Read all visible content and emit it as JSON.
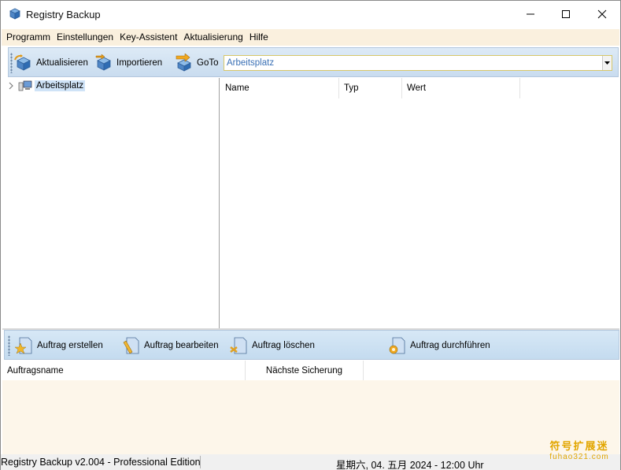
{
  "window": {
    "title": "Registry Backup"
  },
  "menu": [
    "Programm",
    "Einstellungen",
    "Key-Assistent",
    "Aktualisierung",
    "Hilfe"
  ],
  "toolbar": {
    "refresh_label": "Aktualisieren",
    "import_label": "Importieren",
    "goto_label": "GoTo",
    "goto_value": "Arbeitsplatz"
  },
  "tree": {
    "root_label": "Arbeitsplatz"
  },
  "list": {
    "columns": [
      "Name",
      "Typ",
      "Wert"
    ]
  },
  "jobs_toolbar": {
    "create_label": "Auftrag erstellen",
    "edit_label": "Auftrag bearbeiten",
    "delete_label": "Auftrag löschen",
    "run_label": "Auftrag durchführen"
  },
  "jobs": {
    "columns": [
      "Auftragsname",
      "Nächste Sicherung"
    ]
  },
  "status": {
    "left": "Registry Backup v2.004 - Professional Edition",
    "right": "星期六, 04. 五月 2024 - 12:00 Uhr"
  },
  "watermark": {
    "line1": "符号扩展迷",
    "line2": "fuhao321.com"
  },
  "colors": {
    "menu_bg": "#faf0de",
    "toolbar_bg": "#c9dcef",
    "jobs_bg": "#fdf6ea",
    "selection": "#cfe3f7"
  }
}
